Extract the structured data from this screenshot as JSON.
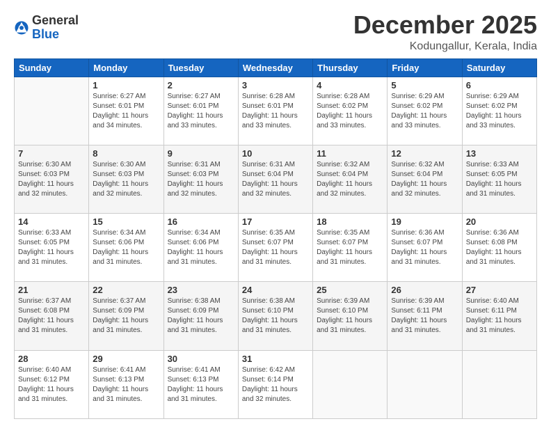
{
  "header": {
    "logo_general": "General",
    "logo_blue": "Blue",
    "month_title": "December 2025",
    "location": "Kodungallur, Kerala, India"
  },
  "weekdays": [
    "Sunday",
    "Monday",
    "Tuesday",
    "Wednesday",
    "Thursday",
    "Friday",
    "Saturday"
  ],
  "weeks": [
    [
      {
        "day": "",
        "info": ""
      },
      {
        "day": "1",
        "info": "Sunrise: 6:27 AM\nSunset: 6:01 PM\nDaylight: 11 hours\nand 34 minutes."
      },
      {
        "day": "2",
        "info": "Sunrise: 6:27 AM\nSunset: 6:01 PM\nDaylight: 11 hours\nand 33 minutes."
      },
      {
        "day": "3",
        "info": "Sunrise: 6:28 AM\nSunset: 6:01 PM\nDaylight: 11 hours\nand 33 minutes."
      },
      {
        "day": "4",
        "info": "Sunrise: 6:28 AM\nSunset: 6:02 PM\nDaylight: 11 hours\nand 33 minutes."
      },
      {
        "day": "5",
        "info": "Sunrise: 6:29 AM\nSunset: 6:02 PM\nDaylight: 11 hours\nand 33 minutes."
      },
      {
        "day": "6",
        "info": "Sunrise: 6:29 AM\nSunset: 6:02 PM\nDaylight: 11 hours\nand 33 minutes."
      }
    ],
    [
      {
        "day": "7",
        "info": "Sunrise: 6:30 AM\nSunset: 6:03 PM\nDaylight: 11 hours\nand 32 minutes."
      },
      {
        "day": "8",
        "info": "Sunrise: 6:30 AM\nSunset: 6:03 PM\nDaylight: 11 hours\nand 32 minutes."
      },
      {
        "day": "9",
        "info": "Sunrise: 6:31 AM\nSunset: 6:03 PM\nDaylight: 11 hours\nand 32 minutes."
      },
      {
        "day": "10",
        "info": "Sunrise: 6:31 AM\nSunset: 6:04 PM\nDaylight: 11 hours\nand 32 minutes."
      },
      {
        "day": "11",
        "info": "Sunrise: 6:32 AM\nSunset: 6:04 PM\nDaylight: 11 hours\nand 32 minutes."
      },
      {
        "day": "12",
        "info": "Sunrise: 6:32 AM\nSunset: 6:04 PM\nDaylight: 11 hours\nand 32 minutes."
      },
      {
        "day": "13",
        "info": "Sunrise: 6:33 AM\nSunset: 6:05 PM\nDaylight: 11 hours\nand 31 minutes."
      }
    ],
    [
      {
        "day": "14",
        "info": "Sunrise: 6:33 AM\nSunset: 6:05 PM\nDaylight: 11 hours\nand 31 minutes."
      },
      {
        "day": "15",
        "info": "Sunrise: 6:34 AM\nSunset: 6:06 PM\nDaylight: 11 hours\nand 31 minutes."
      },
      {
        "day": "16",
        "info": "Sunrise: 6:34 AM\nSunset: 6:06 PM\nDaylight: 11 hours\nand 31 minutes."
      },
      {
        "day": "17",
        "info": "Sunrise: 6:35 AM\nSunset: 6:07 PM\nDaylight: 11 hours\nand 31 minutes."
      },
      {
        "day": "18",
        "info": "Sunrise: 6:35 AM\nSunset: 6:07 PM\nDaylight: 11 hours\nand 31 minutes."
      },
      {
        "day": "19",
        "info": "Sunrise: 6:36 AM\nSunset: 6:07 PM\nDaylight: 11 hours\nand 31 minutes."
      },
      {
        "day": "20",
        "info": "Sunrise: 6:36 AM\nSunset: 6:08 PM\nDaylight: 11 hours\nand 31 minutes."
      }
    ],
    [
      {
        "day": "21",
        "info": "Sunrise: 6:37 AM\nSunset: 6:08 PM\nDaylight: 11 hours\nand 31 minutes."
      },
      {
        "day": "22",
        "info": "Sunrise: 6:37 AM\nSunset: 6:09 PM\nDaylight: 11 hours\nand 31 minutes."
      },
      {
        "day": "23",
        "info": "Sunrise: 6:38 AM\nSunset: 6:09 PM\nDaylight: 11 hours\nand 31 minutes."
      },
      {
        "day": "24",
        "info": "Sunrise: 6:38 AM\nSunset: 6:10 PM\nDaylight: 11 hours\nand 31 minutes."
      },
      {
        "day": "25",
        "info": "Sunrise: 6:39 AM\nSunset: 6:10 PM\nDaylight: 11 hours\nand 31 minutes."
      },
      {
        "day": "26",
        "info": "Sunrise: 6:39 AM\nSunset: 6:11 PM\nDaylight: 11 hours\nand 31 minutes."
      },
      {
        "day": "27",
        "info": "Sunrise: 6:40 AM\nSunset: 6:11 PM\nDaylight: 11 hours\nand 31 minutes."
      }
    ],
    [
      {
        "day": "28",
        "info": "Sunrise: 6:40 AM\nSunset: 6:12 PM\nDaylight: 11 hours\nand 31 minutes."
      },
      {
        "day": "29",
        "info": "Sunrise: 6:41 AM\nSunset: 6:13 PM\nDaylight: 11 hours\nand 31 minutes."
      },
      {
        "day": "30",
        "info": "Sunrise: 6:41 AM\nSunset: 6:13 PM\nDaylight: 11 hours\nand 31 minutes."
      },
      {
        "day": "31",
        "info": "Sunrise: 6:42 AM\nSunset: 6:14 PM\nDaylight: 11 hours\nand 32 minutes."
      },
      {
        "day": "",
        "info": ""
      },
      {
        "day": "",
        "info": ""
      },
      {
        "day": "",
        "info": ""
      }
    ]
  ]
}
